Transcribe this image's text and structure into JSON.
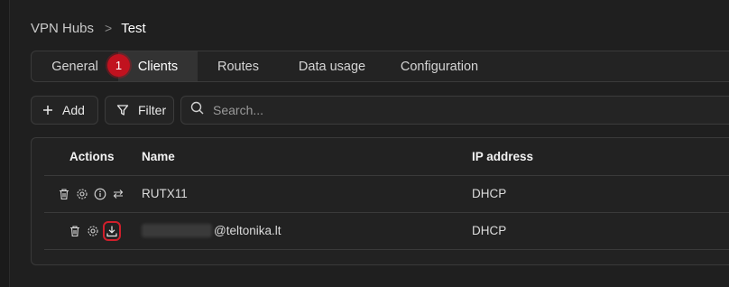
{
  "breadcrumb": {
    "root": "VPN Hubs",
    "separator": ">",
    "current": "Test"
  },
  "tabs": [
    "General",
    "Clients",
    "Routes",
    "Data usage",
    "Configuration"
  ],
  "active_tab": "Clients",
  "step_badge": "1",
  "toolbar": {
    "add_label": "Add",
    "filter_label": "Filter",
    "search_placeholder": "Search..."
  },
  "table": {
    "headers": {
      "actions": "Actions",
      "name": "Name",
      "ip": "IP address"
    },
    "rows": [
      {
        "name": "RUTX11",
        "ip": "DHCP",
        "actions": [
          "trash-icon",
          "gear-icon",
          "info-icon",
          "swap-icon"
        ]
      },
      {
        "name_suffix": "@teltonika.lt",
        "ip": "DHCP",
        "actions": [
          "trash-icon",
          "gear-icon",
          "download-icon"
        ]
      }
    ]
  },
  "colors": {
    "background": "#1f1f1f",
    "highlight": "#c1121f",
    "active_tab": "#333333"
  }
}
